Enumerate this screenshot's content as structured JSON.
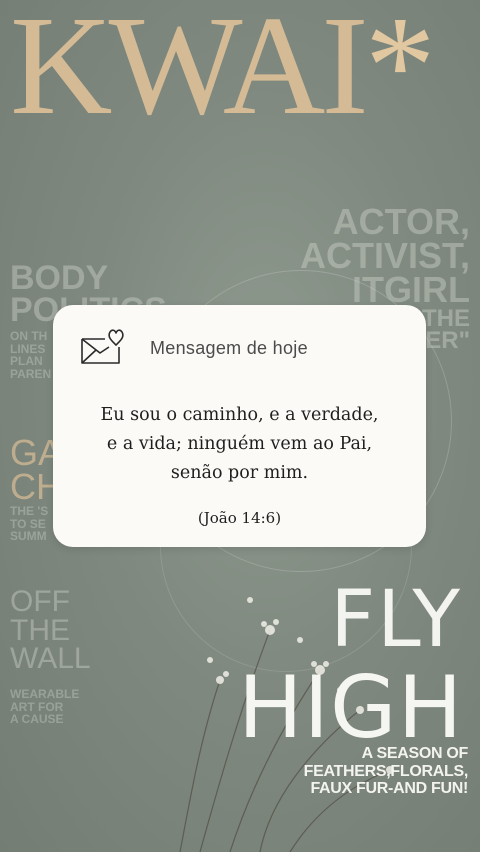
{
  "background": {
    "magazine_title": "KWAI",
    "magazine_title_star": "*",
    "ghost_top_right": [
      "ACTOR,",
      "ACTIVIST,",
      "ITGIRL",
      "THE",
      "VER\""
    ],
    "ghost_body": [
      "BODY",
      "POLITICS"
    ],
    "ghost_body_small": [
      "ON TH",
      "LINES",
      "PLAN",
      "PAREN"
    ],
    "ghost_gold": [
      "GA",
      "CHA"
    ],
    "ghost_gold_small": [
      "THE 'S",
      "TO SE",
      "SUMM"
    ],
    "ghost_wall": [
      "OFF",
      "THE",
      "WALL"
    ],
    "ghost_wall_small": [
      "WEARABLE",
      "ART FOR",
      "A CAUSE"
    ],
    "fly": "FLY",
    "high": "HIGH",
    "season": [
      "A SEASON OF",
      "FEATHERS,FLORALS,",
      "FAUX FUR-AND FUN!"
    ]
  },
  "card": {
    "icon": "envelope-heart-icon",
    "title": "Mensagem de hoje",
    "verse_lines": [
      "Eu sou o caminho, e a verdade,",
      "e a vida; ninguém vem ao Pai,",
      "senão por mim."
    ],
    "reference": "(João 14:6)"
  },
  "colors": {
    "background": "#7f897f",
    "title_gold": "#d4bb95",
    "card": "#fbfaf7"
  }
}
